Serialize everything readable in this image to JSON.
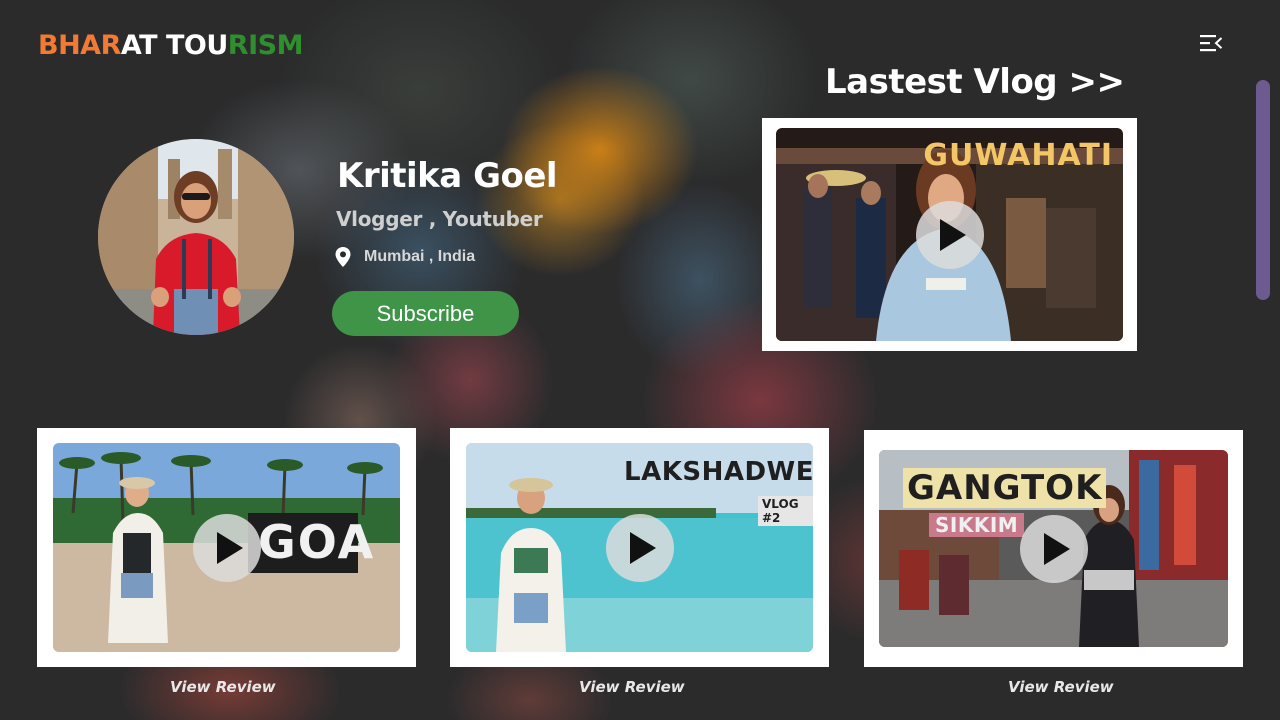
{
  "brand": {
    "part1": "BHAR",
    "part2": "AT TOU",
    "part3": "RISM",
    "colors": {
      "saffron": "#f37a34",
      "white": "#ffffff",
      "green": "#2f8f2f"
    }
  },
  "header": {
    "menu_icon": "menu-collapse-icon"
  },
  "profile": {
    "name": "Kritika Goel",
    "role": "Vlogger , Youtuber",
    "location": "Mumbai , India",
    "location_icon": "location-pin-icon",
    "subscribe_label": "Subscribe"
  },
  "latest": {
    "title": "Lastest Vlog >>",
    "video": {
      "thumb_title": "GUWAHATI",
      "play_icon": "play-icon"
    }
  },
  "reviews": [
    {
      "thumb_title": "GOA",
      "link_label": "View Review"
    },
    {
      "thumb_title": "LAKSHADWEEP",
      "thumb_subtitle": "VLOG #2",
      "link_label": "View Review"
    },
    {
      "thumb_title": "GANGTOK",
      "thumb_subtitle": "SIKKIM",
      "link_label": "View Review"
    }
  ],
  "theme": {
    "subscribe_color": "#3f9448",
    "scrollbar_color": "#6c5a91"
  }
}
